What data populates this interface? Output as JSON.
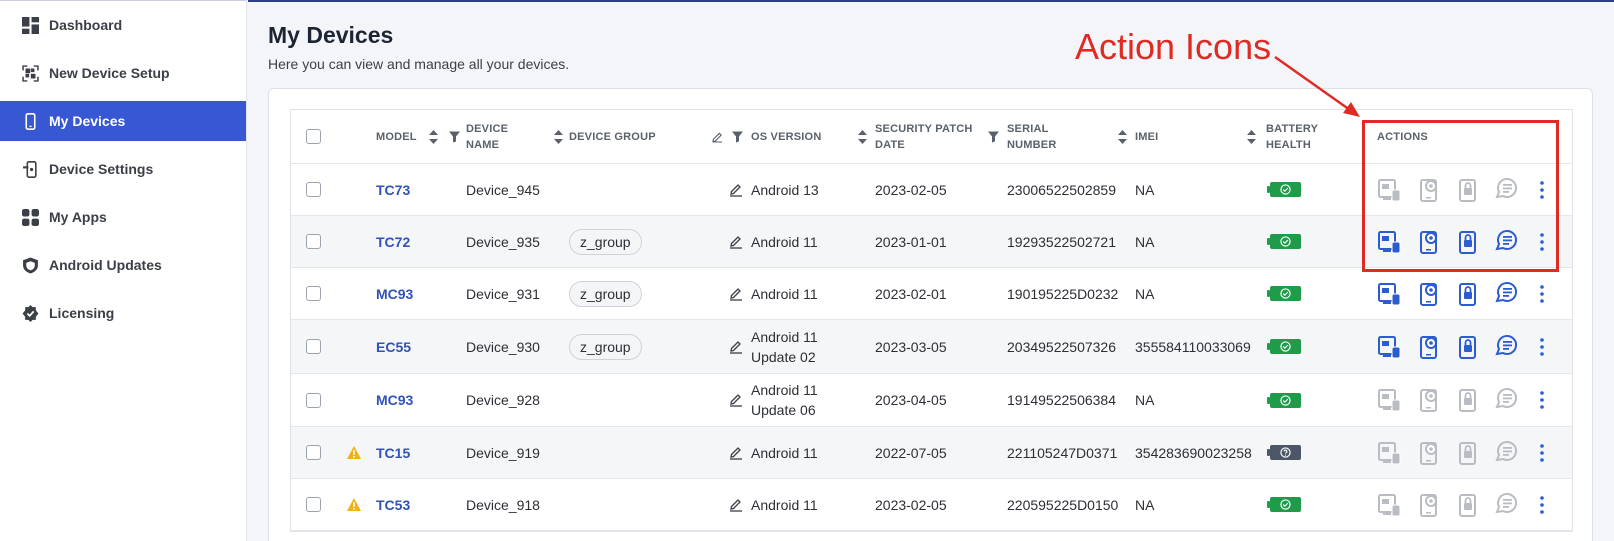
{
  "sidebar": {
    "items": [
      {
        "label": "Dashboard",
        "icon": "dashboard-icon",
        "active": false
      },
      {
        "label": "New Device Setup",
        "icon": "qr-code-icon",
        "active": false
      },
      {
        "label": "My Devices",
        "icon": "phone-icon",
        "active": true
      },
      {
        "label": "Device Settings",
        "icon": "device-settings-icon",
        "active": false
      },
      {
        "label": "My Apps",
        "icon": "apps-icon",
        "active": false
      },
      {
        "label": "Android Updates",
        "icon": "shield-icon",
        "active": false
      },
      {
        "label": "Licensing",
        "icon": "badge-check-icon",
        "active": false
      }
    ]
  },
  "page": {
    "title": "My Devices",
    "subtitle": "Here you can view and manage all your devices."
  },
  "table": {
    "headers": {
      "model": "MODEL",
      "device_name_1": "DEVICE",
      "device_name_2": "NAME",
      "device_group": "DEVICE GROUP",
      "os_version": "OS VERSION",
      "patch_1": "SECURITY PATCH",
      "patch_2": "DATE",
      "serial_1": "SERIAL",
      "serial_2": "NUMBER",
      "imei": "IMEI",
      "battery_1": "BATTERY",
      "battery_2": "HEALTH",
      "actions": "ACTIONS"
    },
    "rows": [
      {
        "warn": false,
        "model": "TC73",
        "name": "Device_945",
        "group": "",
        "os1": "Android 13",
        "os2": "",
        "patch": "2023-02-05",
        "serial": "23006522502859",
        "imei": "NA",
        "battery": "good",
        "actions_enabled": false
      },
      {
        "warn": false,
        "model": "TC72",
        "name": "Device_935",
        "group": "z_group",
        "os1": "Android 11",
        "os2": "",
        "patch": "2023-01-01",
        "serial": "19293522502721",
        "imei": "NA",
        "battery": "good",
        "actions_enabled": true
      },
      {
        "warn": false,
        "model": "MC93",
        "name": "Device_931",
        "group": "z_group",
        "os1": "Android 11",
        "os2": "",
        "patch": "2023-02-01",
        "serial": "190195225D0232",
        "imei": "NA",
        "battery": "good",
        "actions_enabled": true
      },
      {
        "warn": false,
        "model": "EC55",
        "name": "Device_930",
        "group": "z_group",
        "os1": "Android 11",
        "os2": "Update 02",
        "patch": "2023-03-05",
        "serial": "20349522507326",
        "imei": "355584110033069",
        "battery": "good",
        "actions_enabled": true
      },
      {
        "warn": false,
        "model": "MC93",
        "name": "Device_928",
        "group": "",
        "os1": "Android 11",
        "os2": "Update 06",
        "patch": "2023-04-05",
        "serial": "19149522506384",
        "imei": "NA",
        "battery": "good",
        "actions_enabled": false
      },
      {
        "warn": true,
        "model": "TC15",
        "name": "Device_919",
        "group": "",
        "os1": "Android 11",
        "os2": "",
        "patch": "2022-07-05",
        "serial": "221105247D0371",
        "imei": "354283690023258",
        "battery": "unknown",
        "actions_enabled": false
      },
      {
        "warn": true,
        "model": "TC53",
        "name": "Device_918",
        "group": "",
        "os1": "Android 11",
        "os2": "",
        "patch": "2023-02-05",
        "serial": "220595225D0150",
        "imei": "NA",
        "battery": "good",
        "actions_enabled": false
      }
    ]
  },
  "annotation": {
    "label": "Action Icons",
    "color": "#e02b24"
  },
  "colors": {
    "accent": "#3857d3",
    "link": "#3152b7",
    "battery_good": "#1f9b4a",
    "battery_unknown": "#4d5666",
    "warning": "#f2b10f",
    "action_enabled": "#2d5bd0",
    "action_disabled": "#b9bcc2"
  }
}
